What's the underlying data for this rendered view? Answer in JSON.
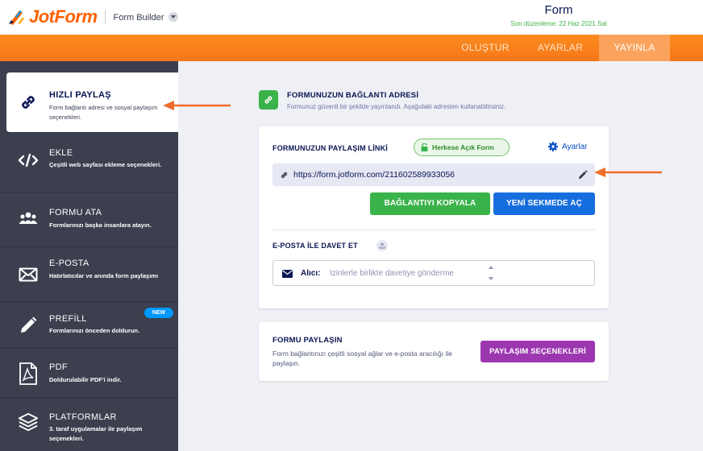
{
  "header": {
    "brand": "JotForm",
    "builder_label": "Form Builder",
    "form_title": "Form",
    "last_edited": "Son düzenleme: 22 Haz 2021 Sal"
  },
  "nav": {
    "items": [
      {
        "label": "OLUŞTUR",
        "active": false
      },
      {
        "label": "AYARLAR",
        "active": false
      },
      {
        "label": "YAYINLA",
        "active": true
      }
    ]
  },
  "sidebar": {
    "items": [
      {
        "title": "HIZLI PAYLAŞ",
        "desc": "Form bağlantı adresi ve sosyal paylaşım seçenekleri.",
        "icon": "link-icon",
        "active": true
      },
      {
        "title": "EKLE",
        "desc": "Çeşitli web sayfası ekleme seçenekleri.",
        "icon": "code-icon",
        "active": false
      },
      {
        "title": "FORMU ATA",
        "desc": "Formlarınızı başka insanlara atayın.",
        "icon": "users-icon",
        "active": false
      },
      {
        "title": "E-POSTA",
        "desc": "Hatırlatıcılar ve anında form paylaşımı",
        "icon": "envelope-icon",
        "active": false
      },
      {
        "title": "PREFİLL",
        "desc": "Formlarınızı önceden doldurun.",
        "icon": "pencil-icon",
        "active": false,
        "badge": "NEW"
      },
      {
        "title": "PDF",
        "desc": "Doldurulabilir PDF'i indir.",
        "icon": "pdf-icon",
        "active": false
      },
      {
        "title": "PLATFORMLAR",
        "desc": "3. taraf uygulamalar ile paylaşım seçenekleri.",
        "icon": "layers-icon",
        "active": false
      }
    ]
  },
  "main": {
    "title": "FORMUNUZUN BAĞLANTI ADRESİ",
    "subtitle": "Formunuz güvenli bir şekilde yayınlandı. Aşağıdaki adresten kullanabilirsiniz.",
    "share_link": {
      "title": "FORMUNUZUN PAYLAŞIM LİNKİ",
      "public_badge": "Herkese Açık Form",
      "settings_label": "Ayarlar",
      "url": "https://form.jotform.com/211602589933056",
      "copy_button": "BAĞLANTIYI KOPYALA",
      "open_button": "YENİ SEKMEDE AÇ"
    },
    "invite": {
      "title": "E-POSTA İLE DAVET ET",
      "to_label": "Alıcı:",
      "placeholder": "İzinlerle birlikte davetiye gönderme"
    },
    "share_form": {
      "title": "FORMU PAYLAŞIN",
      "description": "Form bağlantınızı çeşitli sosyal ağlar ve e-posta aracılığı ile paylaşın.",
      "button": "PAYLAŞIM SEÇENEKLERİ"
    }
  },
  "colors": {
    "brand_orange": "#ff6100",
    "nav_orange": "#f6761a",
    "sidebar_bg": "#3b3f4e",
    "green": "#3ab34a",
    "blue": "#166ede",
    "purple": "#9c37b0",
    "annotation_arrow": "#ef6c2a"
  }
}
